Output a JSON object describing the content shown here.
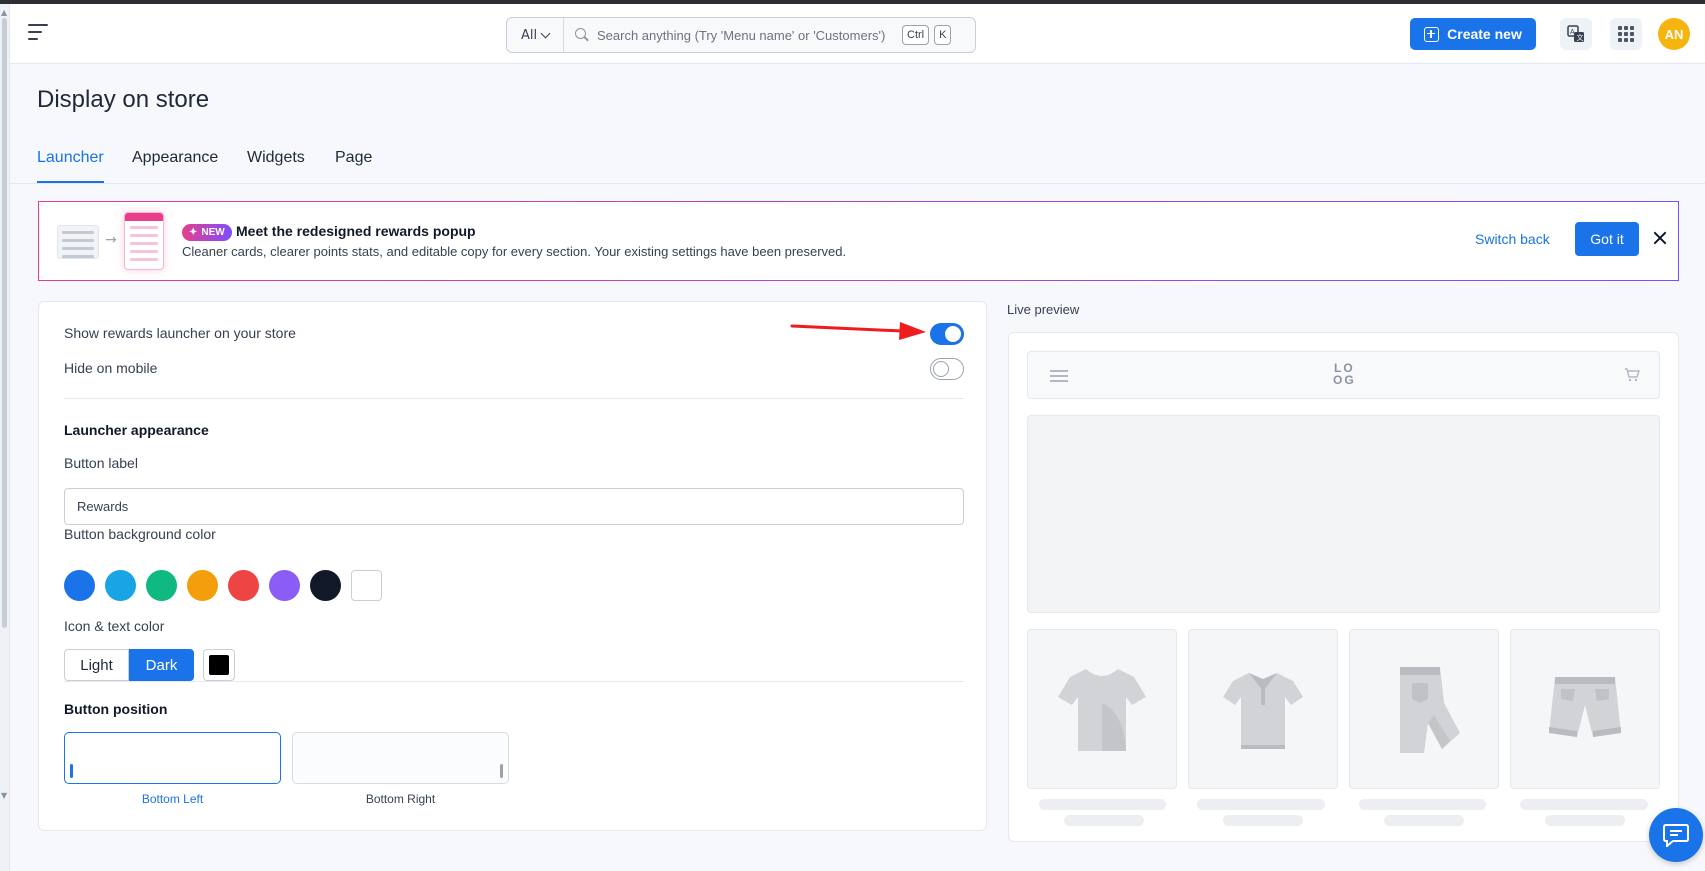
{
  "header": {
    "search_scope": "All",
    "search_placeholder": "Search anything (Try 'Menu name' or 'Customers')",
    "kbd_ctrl": "Ctrl",
    "kbd_k": "K",
    "create_label": "Create new",
    "avatar_initials": "AN"
  },
  "page": {
    "title": "Display on store",
    "tabs": [
      {
        "label": "Launcher",
        "active": true
      },
      {
        "label": "Appearance",
        "active": false
      },
      {
        "label": "Widgets",
        "active": false
      },
      {
        "label": "Page",
        "active": false
      }
    ]
  },
  "banner": {
    "badge": "NEW",
    "title": "Meet the redesigned rewards popup",
    "text": "Cleaner cards, clearer points stats, and editable copy for every section. Your existing settings have been preserved.",
    "switch_back": "Switch back",
    "got_it": "Got it"
  },
  "settings": {
    "show_launcher_label": "Show rewards launcher on your store",
    "show_launcher_on": true,
    "hide_mobile_label": "Hide on mobile",
    "hide_mobile_on": false,
    "section_title": "Launcher appearance",
    "button_label_title": "Button label",
    "button_label_value": "Rewards",
    "bg_color_title": "Button background color",
    "bg_colors": [
      "#1a73e8",
      "#19a4e6",
      "#10b981",
      "#f59e0b",
      "#ef4444",
      "#8b5cf6",
      "#111827",
      "#ffffff"
    ],
    "icon_color_title": "Icon & text color",
    "icon_color_options": [
      "Light",
      "Dark"
    ],
    "icon_color_selected": "Dark",
    "icon_color_swatch": "#000000",
    "position_title": "Button position",
    "positions": [
      "Bottom Left",
      "Bottom Right"
    ],
    "position_selected": "Bottom Left"
  },
  "preview": {
    "label": "Live preview",
    "logo_top": "LO",
    "logo_bottom": "OG"
  },
  "colors": {
    "accent": "#1a73e8",
    "annotation_arrow": "#ee1c1c",
    "avatar": "#f6b40e"
  }
}
